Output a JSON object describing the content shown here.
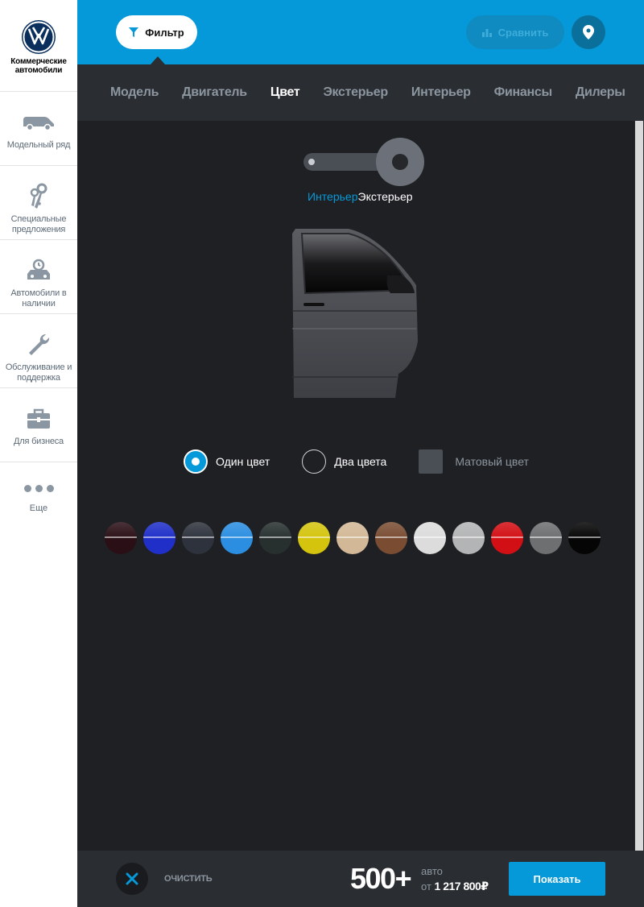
{
  "brand": {
    "line1": "Коммерческие",
    "line2": "автомобили"
  },
  "sidebar": {
    "items": [
      {
        "label": "Модельный ряд",
        "icon": "van-icon"
      },
      {
        "label": "Специальные предложения",
        "icon": "keys-icon"
      },
      {
        "label": "Автомобили в наличии",
        "icon": "car-stock-icon"
      },
      {
        "label": "Обслуживание и поддержка",
        "icon": "wrench-icon"
      },
      {
        "label": "Для бизнеса",
        "icon": "briefcase-icon"
      }
    ],
    "more_label": "Еще"
  },
  "topbar": {
    "filter_label": "Фильтр",
    "compare_label": "Сравнить"
  },
  "tabs": [
    {
      "label": "Модель",
      "active": false
    },
    {
      "label": "Двигатель",
      "active": false
    },
    {
      "label": "Цвет",
      "active": true
    },
    {
      "label": "Экстерьер",
      "active": false
    },
    {
      "label": "Интерьер",
      "active": false
    },
    {
      "label": "Финансы",
      "active": false
    },
    {
      "label": "Дилеры",
      "active": false
    }
  ],
  "view_toggle": {
    "interior_label": "Интерьер",
    "exterior_label": "Экстерьер"
  },
  "color_options": {
    "single": "Один цвет",
    "two": "Два цвета",
    "matte": "Матовый цвет"
  },
  "swatches": [
    {
      "name": "dark-burgundy",
      "color": "#2a0f16"
    },
    {
      "name": "royal-blue",
      "color": "#1f2fc8"
    },
    {
      "name": "graphite",
      "color": "#2e323c"
    },
    {
      "name": "sky-blue",
      "color": "#2b8ee0"
    },
    {
      "name": "dark-slate",
      "color": "#27302f"
    },
    {
      "name": "yellow",
      "color": "#d4c40e"
    },
    {
      "name": "beige",
      "color": "#d2b896"
    },
    {
      "name": "brown",
      "color": "#7a4d33"
    },
    {
      "name": "white",
      "color": "#dcdcdc"
    },
    {
      "name": "silver",
      "color": "#b3b4b6"
    },
    {
      "name": "red",
      "color": "#d20f14"
    },
    {
      "name": "grey",
      "color": "#6e6f71"
    },
    {
      "name": "black",
      "color": "#050505"
    }
  ],
  "bottombar": {
    "clear_label": "ОЧИСТИТЬ",
    "count": "500+",
    "count_unit": "авто",
    "price_prefix": "от",
    "price": "1 217 800₽",
    "show_label": "Показать"
  },
  "colors": {
    "accent": "#0599d9",
    "topbar": "#0599d9",
    "dark": "#1f2023",
    "tabs_bg": "#2a2d31"
  }
}
